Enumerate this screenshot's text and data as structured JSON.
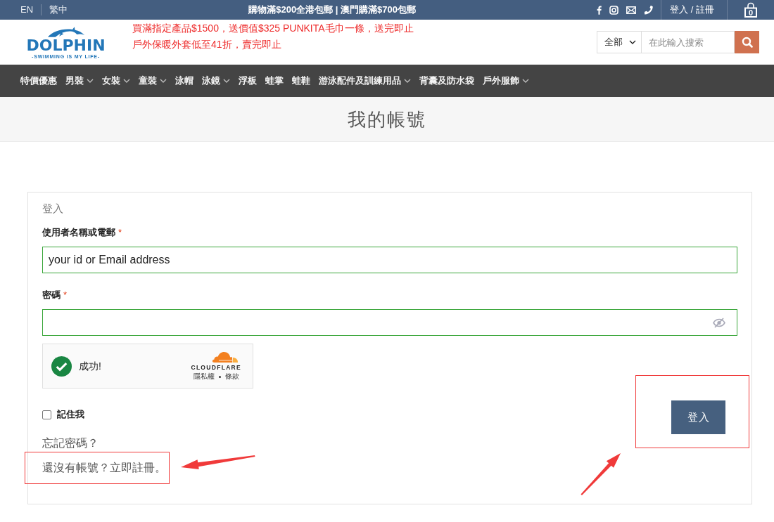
{
  "top_bar": {
    "languages": [
      "EN",
      "繁中"
    ],
    "promo": "購物滿$200全港包郵 | 澳門購滿$700包郵",
    "account_link": "登入 / 註冊",
    "cart_count": "0"
  },
  "header": {
    "logo": {
      "name": "DOLPHIN",
      "tagline": "-SWIMMING IS MY LIFE-"
    },
    "announcements": [
      "買滿指定產品$1500，送價值$325 PUNKITA毛巾一條，送完即止",
      "戶外保暖外套低至41折，賣完即止"
    ],
    "search": {
      "category": "全部",
      "placeholder": "在此輸入搜索"
    }
  },
  "nav": {
    "items": [
      {
        "label": "特價優惠",
        "has_menu": false
      },
      {
        "label": "男裝",
        "has_menu": true
      },
      {
        "label": "女裝",
        "has_menu": true
      },
      {
        "label": "童裝",
        "has_menu": true
      },
      {
        "label": "泳帽",
        "has_menu": false
      },
      {
        "label": "泳鏡",
        "has_menu": true
      },
      {
        "label": "浮板",
        "has_menu": false
      },
      {
        "label": "蛙掌",
        "has_menu": false
      },
      {
        "label": "蛙鞋",
        "has_menu": false
      },
      {
        "label": "游泳配件及訓練用品",
        "has_menu": true
      },
      {
        "label": "背囊及防水袋",
        "has_menu": false
      },
      {
        "label": "戶外服飾",
        "has_menu": true
      }
    ]
  },
  "page_title": "我的帳號",
  "login_form": {
    "heading": "登入",
    "fields": [
      {
        "kind": "text",
        "label": "使用者名稱或電郵",
        "required_mark": "*",
        "value": "your id or Email address"
      },
      {
        "kind": "password",
        "label": "密碼",
        "required_mark": "*"
      }
    ],
    "captcha": {
      "status": "成功!",
      "brand": "CLOUDFLARE",
      "links": [
        "隱私權",
        "條款"
      ]
    },
    "remember": {
      "label": "記住我",
      "checked": false
    },
    "submit": {
      "label": "登入",
      "highlighted": true
    },
    "lost_password": "忘記密碼？",
    "register": {
      "text": "還沒有帳號？立即註冊。",
      "highlighted": true
    }
  }
}
